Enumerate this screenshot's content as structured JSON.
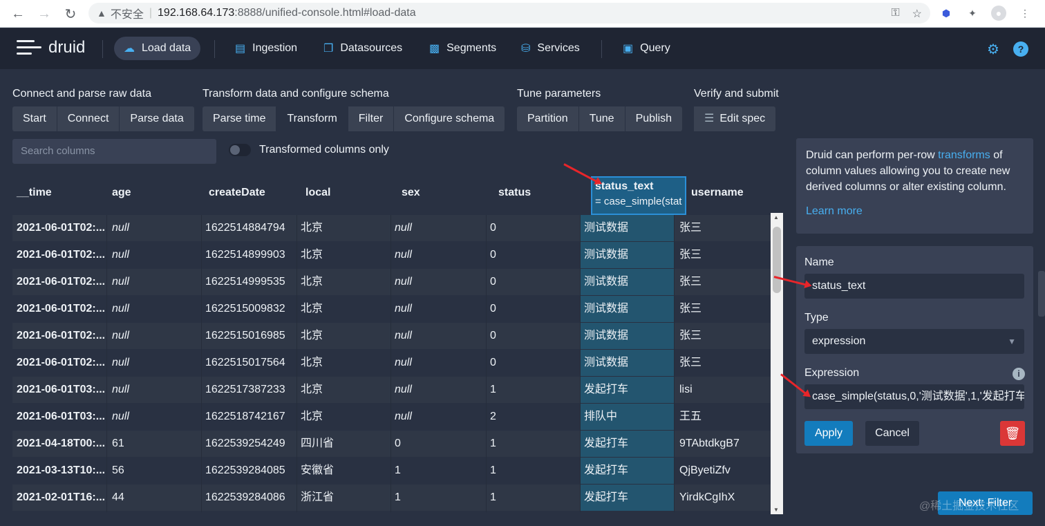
{
  "browser": {
    "warning": "不安全",
    "url_host": "192.168.64.173",
    "url_rest": ":8888/unified-console.html#load-data"
  },
  "app": {
    "logo_text": "druid",
    "nav": [
      {
        "label": "Load data",
        "icon": "cloud-upload-icon"
      },
      {
        "label": "Ingestion",
        "icon": "gantt-icon"
      },
      {
        "label": "Datasources",
        "icon": "multi-select-icon"
      },
      {
        "label": "Segments",
        "icon": "stacked-chart-icon"
      },
      {
        "label": "Services",
        "icon": "database-icon"
      },
      {
        "label": "Query",
        "icon": "application-icon"
      }
    ]
  },
  "steps": {
    "connect": {
      "title": "Connect and parse raw data",
      "buttons": [
        "Start",
        "Connect",
        "Parse data"
      ]
    },
    "transform": {
      "title": "Transform data and configure schema",
      "buttons": [
        "Parse time",
        "Transform",
        "Filter",
        "Configure schema"
      ]
    },
    "tune": {
      "title": "Tune parameters",
      "buttons": [
        "Partition",
        "Tune",
        "Publish"
      ]
    },
    "verify": {
      "title": "Verify and submit",
      "buttons": [
        "Edit spec"
      ]
    }
  },
  "search": {
    "placeholder": "Search columns"
  },
  "toggle_label": "Transformed columns only",
  "table": {
    "columns": [
      "__time",
      "age",
      "createDate",
      "local",
      "sex",
      "status",
      "status_text",
      "username"
    ],
    "selected_column_expr": "= case_simple(stat",
    "rows": [
      [
        "2021-06-01T02:...",
        "null",
        "1622514884794",
        "北京",
        "null",
        "0",
        "测试数据",
        "张三"
      ],
      [
        "2021-06-01T02:...",
        "null",
        "1622514899903",
        "北京",
        "null",
        "0",
        "测试数据",
        "张三"
      ],
      [
        "2021-06-01T02:...",
        "null",
        "1622514999535",
        "北京",
        "null",
        "0",
        "测试数据",
        "张三"
      ],
      [
        "2021-06-01T02:...",
        "null",
        "1622515009832",
        "北京",
        "null",
        "0",
        "测试数据",
        "张三"
      ],
      [
        "2021-06-01T02:...",
        "null",
        "1622515016985",
        "北京",
        "null",
        "0",
        "测试数据",
        "张三"
      ],
      [
        "2021-06-01T02:...",
        "null",
        "1622515017564",
        "北京",
        "null",
        "0",
        "测试数据",
        "张三"
      ],
      [
        "2021-06-01T03:...",
        "null",
        "1622517387233",
        "北京",
        "null",
        "1",
        "发起打车",
        "lisi"
      ],
      [
        "2021-06-01T03:...",
        "null",
        "1622518742167",
        "北京",
        "null",
        "2",
        "排队中",
        "王五"
      ],
      [
        "2021-04-18T00:...",
        "61",
        "1622539254249",
        "四川省",
        "0",
        "1",
        "发起打车",
        "9TAbtdkgB7"
      ],
      [
        "2021-03-13T10:...",
        "56",
        "1622539284085",
        "安徽省",
        "1",
        "1",
        "发起打车",
        "QjByetiZfv"
      ],
      [
        "2021-02-01T16:...",
        "44",
        "1622539284086",
        "浙江省",
        "1",
        "1",
        "发起打车",
        "YirdkCgIhX"
      ]
    ]
  },
  "info": {
    "text_before": "Druid can perform per-row ",
    "link": "transforms",
    "text_after": " of column values allowing you to create new derived columns or alter existing column.",
    "learn_more": "Learn more"
  },
  "editor": {
    "name_label": "Name",
    "name_value": "status_text",
    "type_label": "Type",
    "type_value": "expression",
    "expression_label": "Expression",
    "expression_value": "case_simple(status,0,'测试数据',1,'发起打车",
    "apply": "Apply",
    "cancel": "Cancel"
  },
  "next_button": "Next: Filter",
  "watermark": "@稀土掘金技术社区",
  "colors": {
    "accent": "#48aff0",
    "primary": "#137cbd",
    "danger": "#db3737",
    "annotation": "#e8252a"
  }
}
